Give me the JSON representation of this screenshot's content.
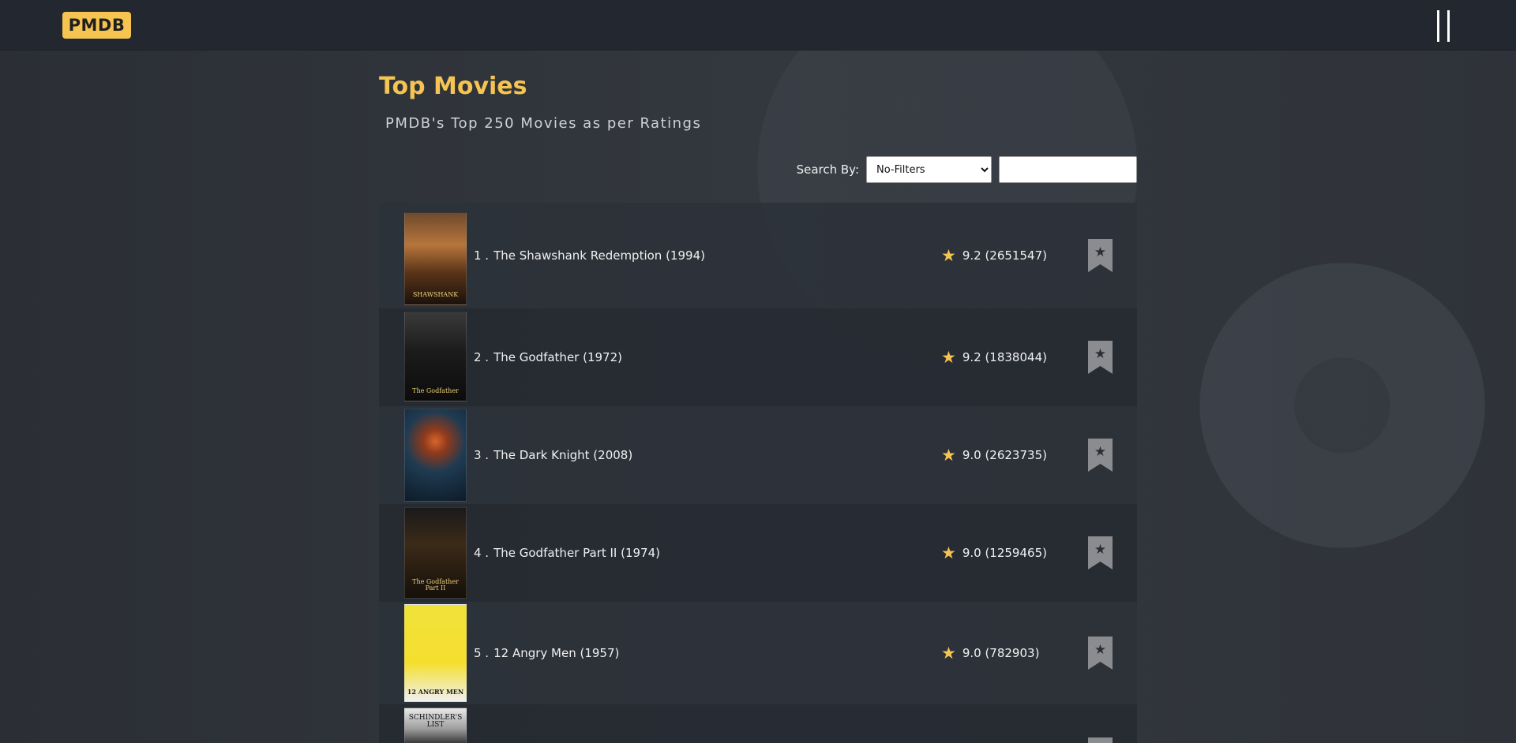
{
  "header": {
    "logo_text": "PMDB",
    "menu_icon": "hamburger-menu-icon"
  },
  "page": {
    "title": "Top Movies",
    "subtitle": "PMDB's Top 250 Movies as per Ratings"
  },
  "search": {
    "label": "Search By:",
    "filter_selected": "No-Filters",
    "query_value": "",
    "query_placeholder": ""
  },
  "movies": [
    {
      "rank": "1 .",
      "title": "The Shawshank Redemption (1994)",
      "rating": "9.2 (2651547)",
      "poster_text": "SHAWSHANK"
    },
    {
      "rank": "2 .",
      "title": "The Godfather (1972)",
      "rating": "9.2 (1838044)",
      "poster_text": "The Godfather"
    },
    {
      "rank": "3 .",
      "title": "The Dark Knight (2008)",
      "rating": "9.0 (2623735)",
      "poster_text": ""
    },
    {
      "rank": "4 .",
      "title": "The Godfather Part II (1974)",
      "rating": "9.0 (1259465)",
      "poster_text": "The Godfather Part II"
    },
    {
      "rank": "5 .",
      "title": "12 Angry Men (1957)",
      "rating": "9.0 (782903)",
      "poster_text": "12 ANGRY MEN"
    },
    {
      "rank": "",
      "title": "",
      "rating": "",
      "poster_text": "SCHINDLER'S LIST"
    }
  ],
  "colors": {
    "accent": "#f5c451",
    "topbar": "#222730",
    "background": "#2b2f35"
  }
}
